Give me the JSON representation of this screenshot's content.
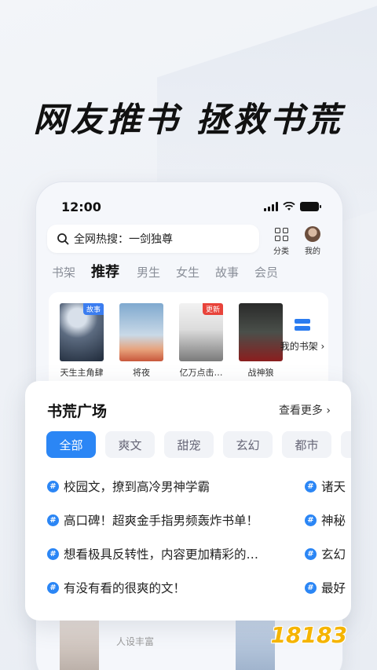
{
  "headline": "网友推书 拯救书荒",
  "status_bar": {
    "time": "12:00"
  },
  "search": {
    "text": "全网热搜：一剑独尊"
  },
  "top_actions": [
    {
      "label": "分类",
      "icon": "grid-icon"
    },
    {
      "label": "我的",
      "icon": "avatar"
    }
  ],
  "tabs": [
    "书架",
    "推荐",
    "男生",
    "女生",
    "故事",
    "会员"
  ],
  "active_tab": "推荐",
  "books": [
    {
      "title": "天生主角肆",
      "tag": "故事",
      "tag_color": "#3b7df0"
    },
    {
      "title": "将夜",
      "tag": "",
      "tag_color": ""
    },
    {
      "title": "亿万点击…",
      "tag": "更新",
      "tag_color": "#e8433a"
    },
    {
      "title": "战神狼",
      "tag": "",
      "tag_color": ""
    }
  ],
  "my_shelf": {
    "label": "我的书架 ›"
  },
  "card": {
    "title": "书荒广场",
    "more": "查看更多 ›",
    "chips": [
      "全部",
      "爽文",
      "甜宠",
      "玄幻",
      "都市"
    ],
    "active_chip": "全部",
    "topics": [
      "校园文，撩到高冷男神学霸",
      "高口碑！超爽金手指男频轰炸书单！",
      "想看极具反转性，内容更加精彩的…",
      "有没有看的很爽的文！"
    ],
    "topics_right": [
      "诸天",
      "神秘",
      "玄幻",
      "最好"
    ]
  },
  "peek_text": "人设丰富",
  "watermark": "18183",
  "colors": {
    "accent": "#2b86f5",
    "hash": "#2b86f5",
    "shelf_icon": "#2b7cf0"
  }
}
